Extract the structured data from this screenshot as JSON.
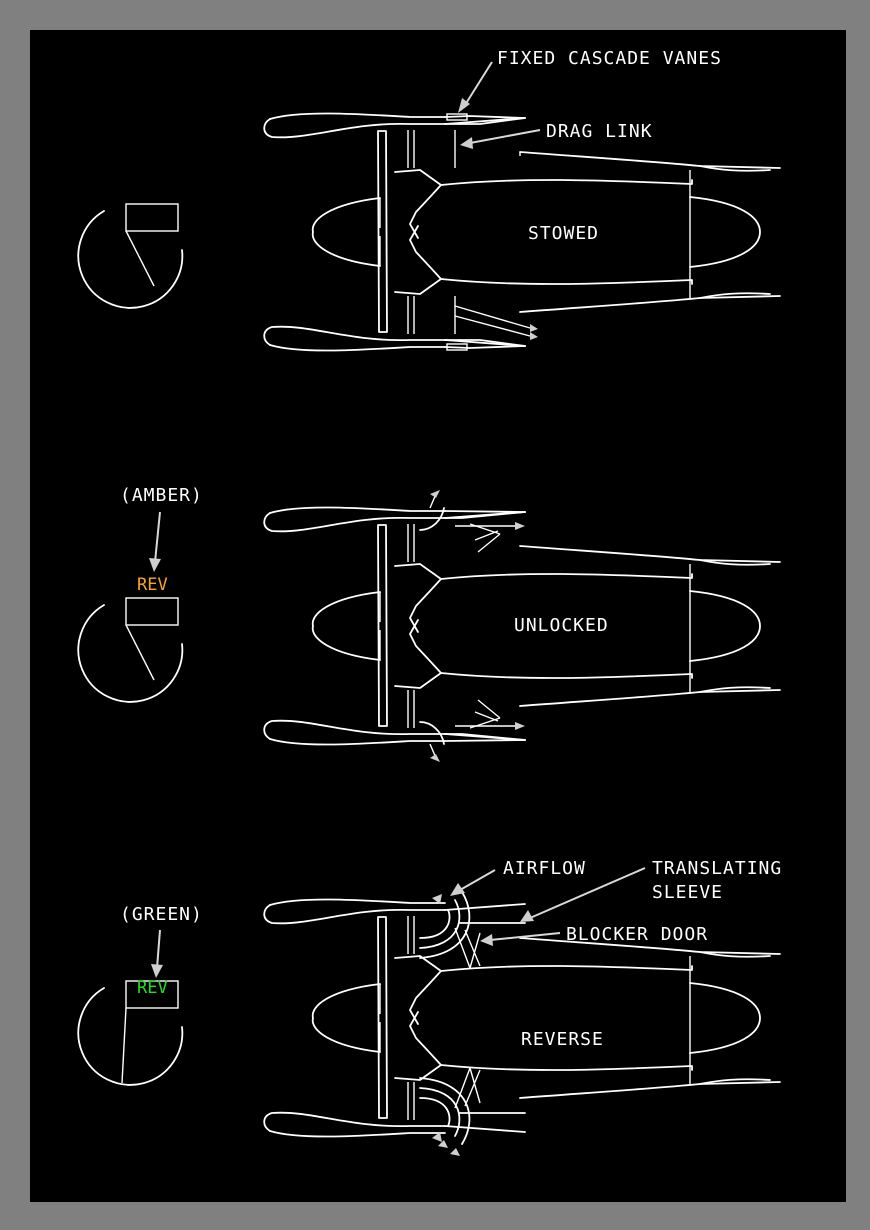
{
  "colors": {
    "border": "#808080",
    "background": "#000000",
    "line": "#ffffff",
    "amber": "#f5a623",
    "green": "#22dd22"
  },
  "labels": {
    "fixed_cascade_vanes": "FIXED CASCADE VANES",
    "drag_link": "DRAG LINK",
    "airflow": "AIRFLOW",
    "translating_sleeve_1": "TRANSLATING",
    "translating_sleeve_2": "SLEEVE",
    "blocker_door": "BLOCKER DOOR"
  },
  "states": [
    {
      "label": "STOWED",
      "indicator_note": "",
      "indicator_text": "",
      "indicator_color": ""
    },
    {
      "label": "UNLOCKED",
      "indicator_note": "(AMBER)",
      "indicator_text": "REV",
      "indicator_color": "#f5a623"
    },
    {
      "label": "REVERSE",
      "indicator_note": "(GREEN)",
      "indicator_text": "REV",
      "indicator_color": "#22dd22"
    }
  ]
}
